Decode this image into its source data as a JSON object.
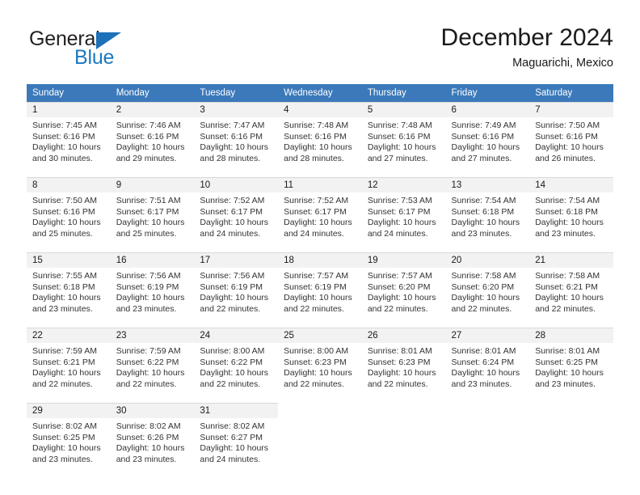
{
  "brand": {
    "name_top": "General",
    "name_bottom": "Blue",
    "triangle_color": "#1c71b8",
    "blue_color": "#1c79c0"
  },
  "header": {
    "month_title": "December 2024",
    "location": "Maguarichi, Mexico"
  },
  "colors": {
    "header_blue": "#3b79ba",
    "daynum_band": "#f2f2f2",
    "cell_bg": "#ffffff",
    "text": "#333333",
    "border": "#d9d9d9"
  },
  "weekdays": [
    "Sunday",
    "Monday",
    "Tuesday",
    "Wednesday",
    "Thursday",
    "Friday",
    "Saturday"
  ],
  "weeks": [
    [
      {
        "day": "1",
        "sunrise": "Sunrise: 7:45 AM",
        "sunset": "Sunset: 6:16 PM",
        "daylight1": "Daylight: 10 hours",
        "daylight2": "and 30 minutes."
      },
      {
        "day": "2",
        "sunrise": "Sunrise: 7:46 AM",
        "sunset": "Sunset: 6:16 PM",
        "daylight1": "Daylight: 10 hours",
        "daylight2": "and 29 minutes."
      },
      {
        "day": "3",
        "sunrise": "Sunrise: 7:47 AM",
        "sunset": "Sunset: 6:16 PM",
        "daylight1": "Daylight: 10 hours",
        "daylight2": "and 28 minutes."
      },
      {
        "day": "4",
        "sunrise": "Sunrise: 7:48 AM",
        "sunset": "Sunset: 6:16 PM",
        "daylight1": "Daylight: 10 hours",
        "daylight2": "and 28 minutes."
      },
      {
        "day": "5",
        "sunrise": "Sunrise: 7:48 AM",
        "sunset": "Sunset: 6:16 PM",
        "daylight1": "Daylight: 10 hours",
        "daylight2": "and 27 minutes."
      },
      {
        "day": "6",
        "sunrise": "Sunrise: 7:49 AM",
        "sunset": "Sunset: 6:16 PM",
        "daylight1": "Daylight: 10 hours",
        "daylight2": "and 27 minutes."
      },
      {
        "day": "7",
        "sunrise": "Sunrise: 7:50 AM",
        "sunset": "Sunset: 6:16 PM",
        "daylight1": "Daylight: 10 hours",
        "daylight2": "and 26 minutes."
      }
    ],
    [
      {
        "day": "8",
        "sunrise": "Sunrise: 7:50 AM",
        "sunset": "Sunset: 6:16 PM",
        "daylight1": "Daylight: 10 hours",
        "daylight2": "and 25 minutes."
      },
      {
        "day": "9",
        "sunrise": "Sunrise: 7:51 AM",
        "sunset": "Sunset: 6:17 PM",
        "daylight1": "Daylight: 10 hours",
        "daylight2": "and 25 minutes."
      },
      {
        "day": "10",
        "sunrise": "Sunrise: 7:52 AM",
        "sunset": "Sunset: 6:17 PM",
        "daylight1": "Daylight: 10 hours",
        "daylight2": "and 24 minutes."
      },
      {
        "day": "11",
        "sunrise": "Sunrise: 7:52 AM",
        "sunset": "Sunset: 6:17 PM",
        "daylight1": "Daylight: 10 hours",
        "daylight2": "and 24 minutes."
      },
      {
        "day": "12",
        "sunrise": "Sunrise: 7:53 AM",
        "sunset": "Sunset: 6:17 PM",
        "daylight1": "Daylight: 10 hours",
        "daylight2": "and 24 minutes."
      },
      {
        "day": "13",
        "sunrise": "Sunrise: 7:54 AM",
        "sunset": "Sunset: 6:18 PM",
        "daylight1": "Daylight: 10 hours",
        "daylight2": "and 23 minutes."
      },
      {
        "day": "14",
        "sunrise": "Sunrise: 7:54 AM",
        "sunset": "Sunset: 6:18 PM",
        "daylight1": "Daylight: 10 hours",
        "daylight2": "and 23 minutes."
      }
    ],
    [
      {
        "day": "15",
        "sunrise": "Sunrise: 7:55 AM",
        "sunset": "Sunset: 6:18 PM",
        "daylight1": "Daylight: 10 hours",
        "daylight2": "and 23 minutes."
      },
      {
        "day": "16",
        "sunrise": "Sunrise: 7:56 AM",
        "sunset": "Sunset: 6:19 PM",
        "daylight1": "Daylight: 10 hours",
        "daylight2": "and 23 minutes."
      },
      {
        "day": "17",
        "sunrise": "Sunrise: 7:56 AM",
        "sunset": "Sunset: 6:19 PM",
        "daylight1": "Daylight: 10 hours",
        "daylight2": "and 22 minutes."
      },
      {
        "day": "18",
        "sunrise": "Sunrise: 7:57 AM",
        "sunset": "Sunset: 6:19 PM",
        "daylight1": "Daylight: 10 hours",
        "daylight2": "and 22 minutes."
      },
      {
        "day": "19",
        "sunrise": "Sunrise: 7:57 AM",
        "sunset": "Sunset: 6:20 PM",
        "daylight1": "Daylight: 10 hours",
        "daylight2": "and 22 minutes."
      },
      {
        "day": "20",
        "sunrise": "Sunrise: 7:58 AM",
        "sunset": "Sunset: 6:20 PM",
        "daylight1": "Daylight: 10 hours",
        "daylight2": "and 22 minutes."
      },
      {
        "day": "21",
        "sunrise": "Sunrise: 7:58 AM",
        "sunset": "Sunset: 6:21 PM",
        "daylight1": "Daylight: 10 hours",
        "daylight2": "and 22 minutes."
      }
    ],
    [
      {
        "day": "22",
        "sunrise": "Sunrise: 7:59 AM",
        "sunset": "Sunset: 6:21 PM",
        "daylight1": "Daylight: 10 hours",
        "daylight2": "and 22 minutes."
      },
      {
        "day": "23",
        "sunrise": "Sunrise: 7:59 AM",
        "sunset": "Sunset: 6:22 PM",
        "daylight1": "Daylight: 10 hours",
        "daylight2": "and 22 minutes."
      },
      {
        "day": "24",
        "sunrise": "Sunrise: 8:00 AM",
        "sunset": "Sunset: 6:22 PM",
        "daylight1": "Daylight: 10 hours",
        "daylight2": "and 22 minutes."
      },
      {
        "day": "25",
        "sunrise": "Sunrise: 8:00 AM",
        "sunset": "Sunset: 6:23 PM",
        "daylight1": "Daylight: 10 hours",
        "daylight2": "and 22 minutes."
      },
      {
        "day": "26",
        "sunrise": "Sunrise: 8:01 AM",
        "sunset": "Sunset: 6:23 PM",
        "daylight1": "Daylight: 10 hours",
        "daylight2": "and 22 minutes."
      },
      {
        "day": "27",
        "sunrise": "Sunrise: 8:01 AM",
        "sunset": "Sunset: 6:24 PM",
        "daylight1": "Daylight: 10 hours",
        "daylight2": "and 23 minutes."
      },
      {
        "day": "28",
        "sunrise": "Sunrise: 8:01 AM",
        "sunset": "Sunset: 6:25 PM",
        "daylight1": "Daylight: 10 hours",
        "daylight2": "and 23 minutes."
      }
    ],
    [
      {
        "day": "29",
        "sunrise": "Sunrise: 8:02 AM",
        "sunset": "Sunset: 6:25 PM",
        "daylight1": "Daylight: 10 hours",
        "daylight2": "and 23 minutes."
      },
      {
        "day": "30",
        "sunrise": "Sunrise: 8:02 AM",
        "sunset": "Sunset: 6:26 PM",
        "daylight1": "Daylight: 10 hours",
        "daylight2": "and 23 minutes."
      },
      {
        "day": "31",
        "sunrise": "Sunrise: 8:02 AM",
        "sunset": "Sunset: 6:27 PM",
        "daylight1": "Daylight: 10 hours",
        "daylight2": "and 24 minutes."
      },
      {
        "day": "",
        "sunrise": "",
        "sunset": "",
        "daylight1": "",
        "daylight2": ""
      },
      {
        "day": "",
        "sunrise": "",
        "sunset": "",
        "daylight1": "",
        "daylight2": ""
      },
      {
        "day": "",
        "sunrise": "",
        "sunset": "",
        "daylight1": "",
        "daylight2": ""
      },
      {
        "day": "",
        "sunrise": "",
        "sunset": "",
        "daylight1": "",
        "daylight2": ""
      }
    ]
  ]
}
